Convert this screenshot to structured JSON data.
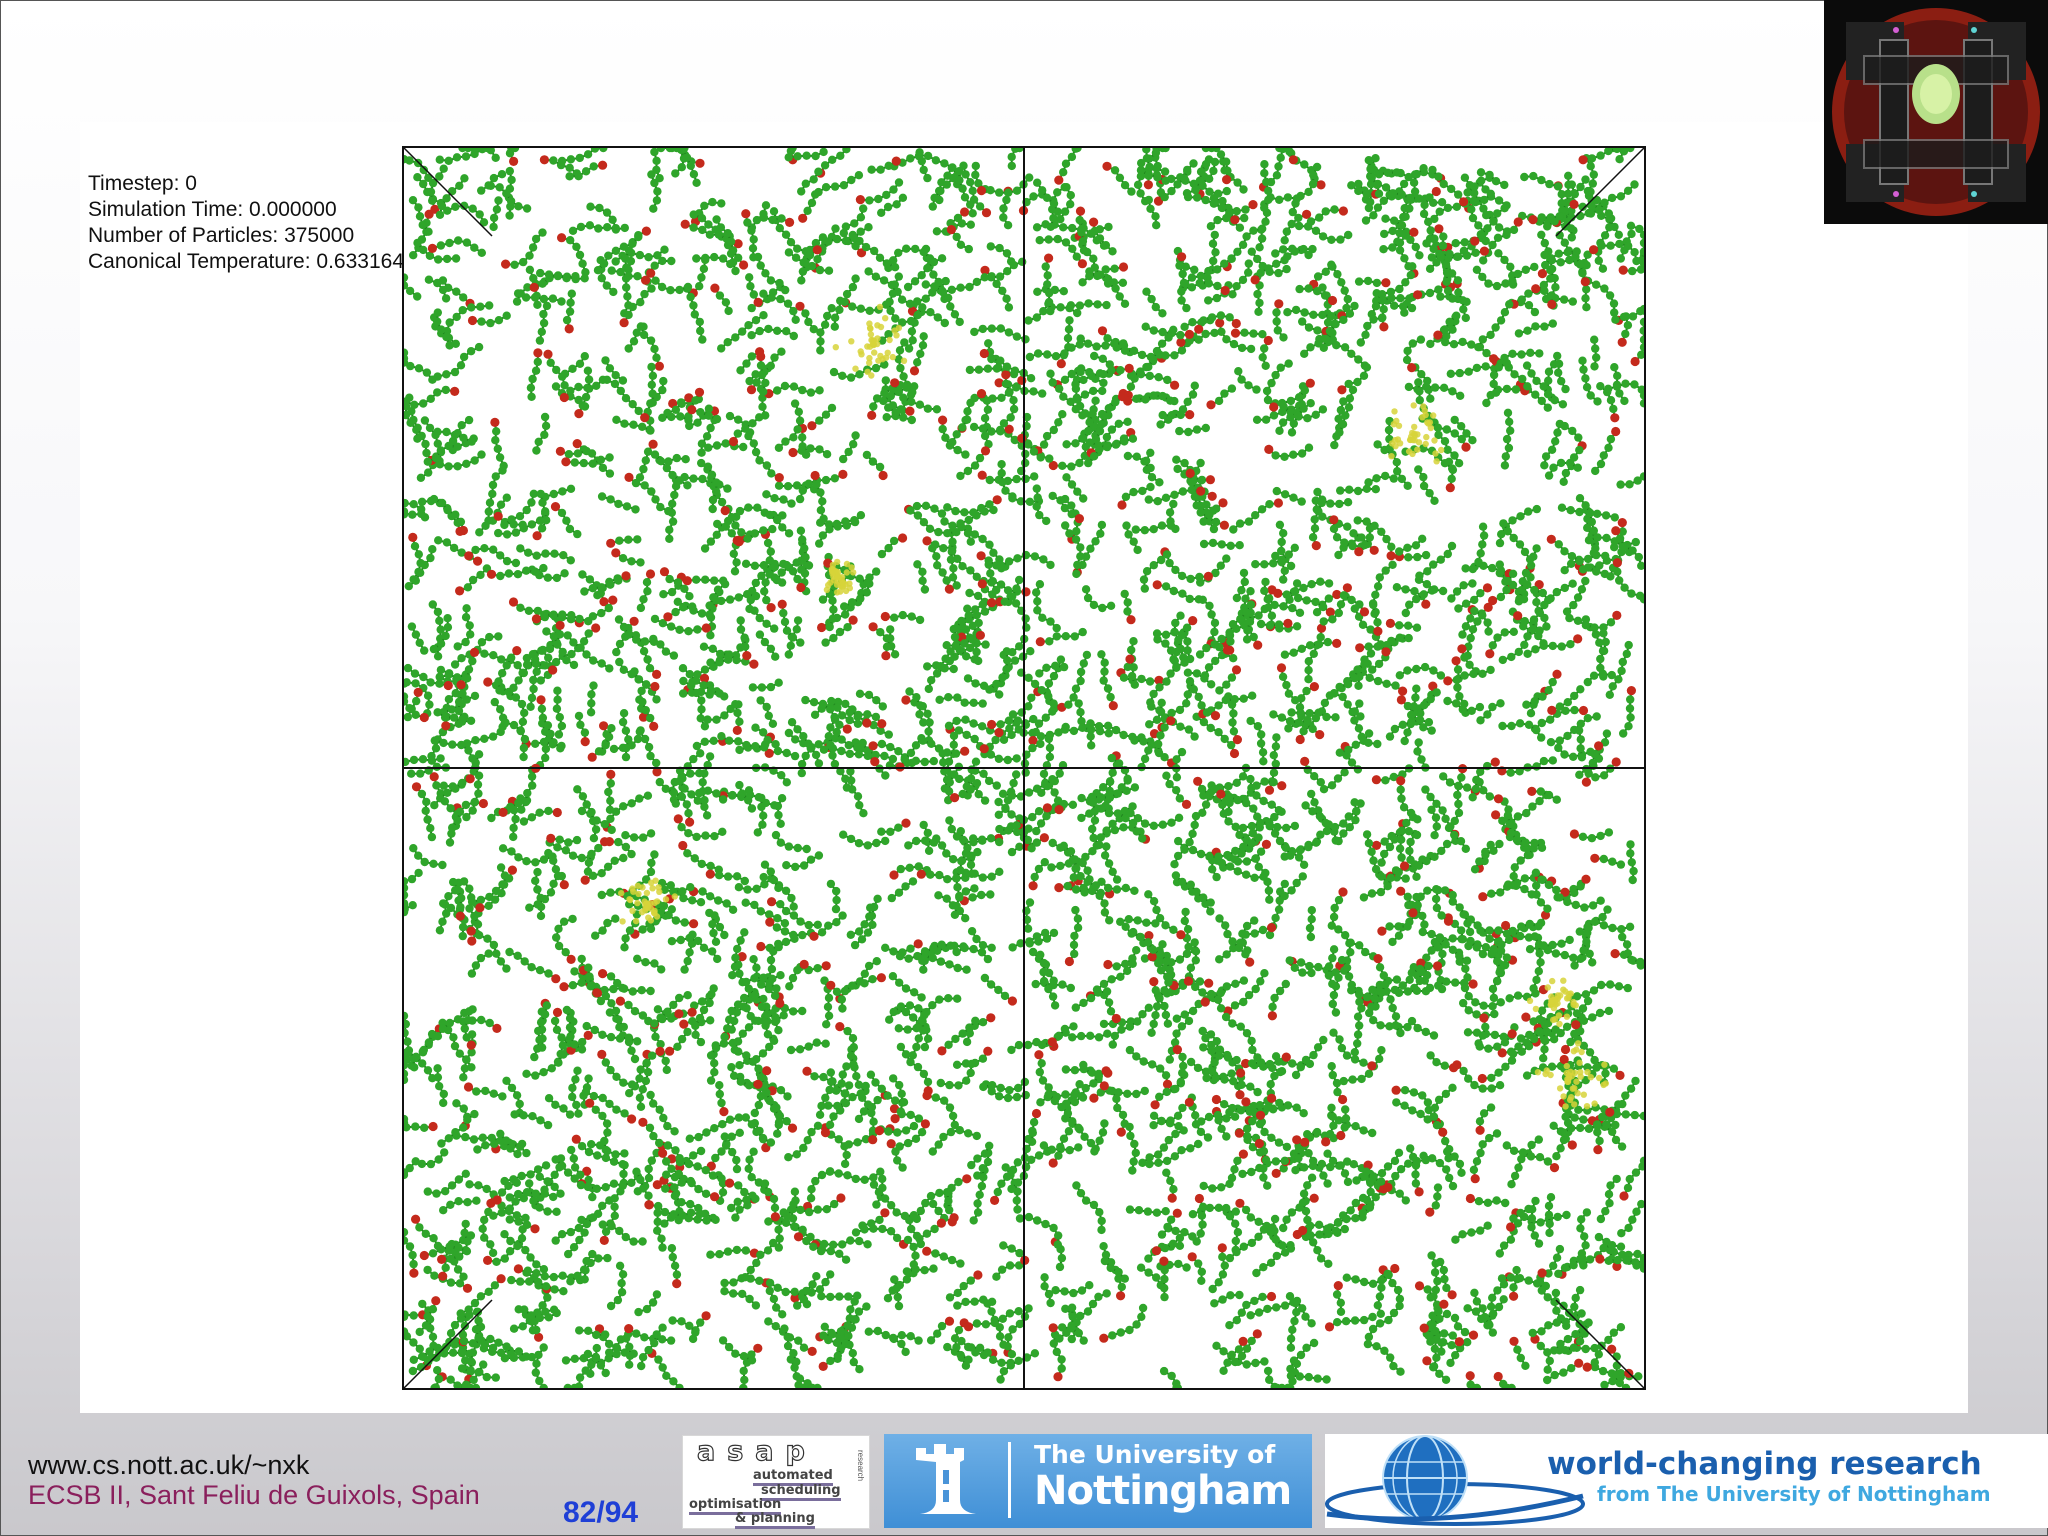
{
  "simulation": {
    "timestep": "Timestep: 0",
    "sim_time": "Simulation Time: 0.000000",
    "particles": "Number of Particles: 375000",
    "temperature": "Canonical Temperature: 0.633164"
  },
  "colors": {
    "chain": "#2fa52a",
    "chain_dark": "#1d7f1c",
    "head": "#c42a1c",
    "cluster": "#d7d43a",
    "box_line": "#111111"
  },
  "footer": {
    "url": "www.cs.nott.ac.uk/~nxk",
    "venue": "ECSB II, Sant Feliu de Guixols, Spain",
    "page": "82/94"
  },
  "logos": {
    "asap": {
      "word": "asap",
      "tag": "research",
      "line1": "automated",
      "line2": "scheduling",
      "line3": "optimisation",
      "line4": "& planning"
    },
    "uon": {
      "small": "The University of",
      "big": "Nottingham"
    },
    "wcr": {
      "line1": "world-changing research",
      "line2": "from The University of Nottingham"
    }
  },
  "icons": {
    "thumbnail": "simulation-thumbnail-icon",
    "castle": "castle-crest-icon",
    "globe": "globe-icon"
  }
}
